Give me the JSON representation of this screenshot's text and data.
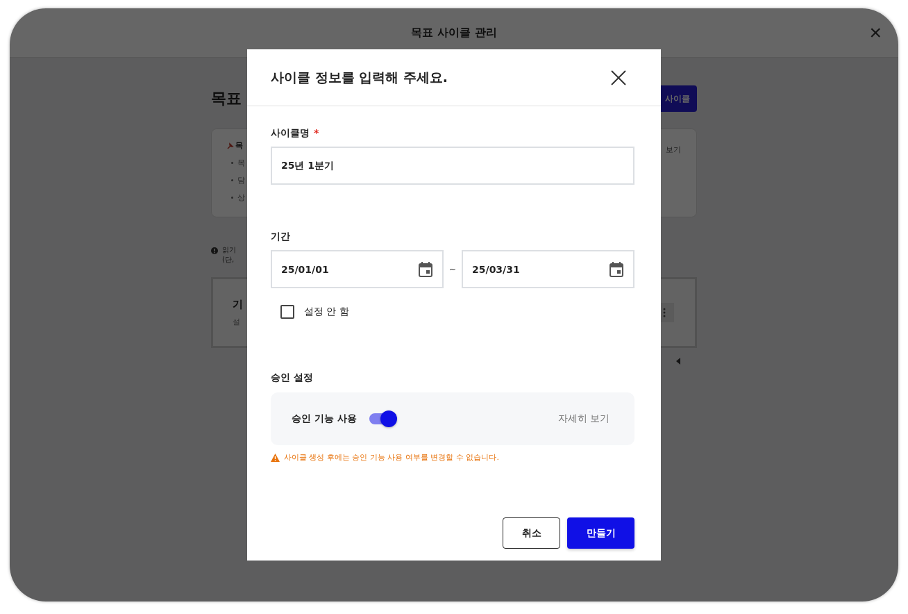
{
  "window": {
    "title": "목표 사이클 관리",
    "close": "×"
  },
  "page": {
    "title": "목표",
    "new_button": "사이클",
    "guide": {
      "heading": "목",
      "bullets": [
        "목",
        "담",
        "상"
      ],
      "link": "보기"
    },
    "notice": [
      "읽기",
      "(단,"
    ],
    "cycle_card": {
      "title": "기",
      "subtitle": "설"
    }
  },
  "dialog": {
    "title": "사이클 정보를 입력해 주세요.",
    "name_field": {
      "label": "사이클명",
      "required": "*",
      "value": "25년 1분기"
    },
    "period": {
      "label": "기간",
      "start": "25/01/01",
      "separator": "~",
      "end": "25/03/31",
      "no_period": {
        "label": "설정 안 함",
        "checked": false
      }
    },
    "approval": {
      "label": "승인 설정",
      "toggle_label": "승인 기능 사용",
      "on": true,
      "details_link": "자세히 보기",
      "warning": "사이클 생성 후에는 승인 기능 사용 여부를 변경할 수 없습니다."
    },
    "buttons": [
      {
        "label": "취소",
        "kind": "secondary"
      },
      {
        "label": "만들기",
        "kind": "primary"
      }
    ]
  }
}
